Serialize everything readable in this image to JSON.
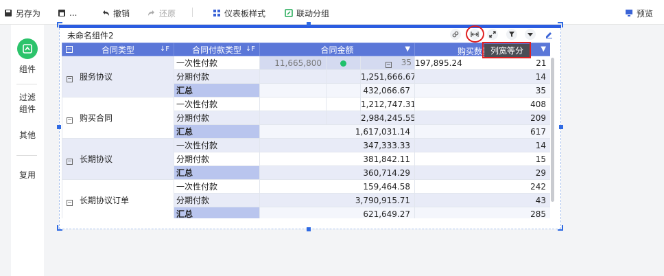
{
  "toolbar": {
    "save_as": "另存为",
    "export": "...",
    "undo": "撤销",
    "redo": "还原",
    "dashboard_style": "仪表板样式",
    "link_group": "联动分组",
    "preview": "预览"
  },
  "sidebar": {
    "items": [
      {
        "label": "组件"
      },
      {
        "label": "过滤\n组件"
      },
      {
        "label": "其他"
      },
      {
        "label": "复用"
      }
    ]
  },
  "widget": {
    "title": "未命名组件2",
    "tooltip": "列宽等分"
  },
  "table": {
    "headers": [
      "合同类型",
      "合同付款类型",
      "合同金额",
      "购买数量"
    ],
    "highlight_cell": {
      "value1": "11,665,800",
      "value2": "35"
    },
    "groups": [
      {
        "name": "服务协议",
        "rows": [
          {
            "type": "一次性付款",
            "amount": "197,895.24",
            "qty": "21"
          },
          {
            "type": "分期付款",
            "amount": "1,251,666.67",
            "qty": "14"
          },
          {
            "type": "汇总",
            "amount": "432,066.67",
            "qty": "35"
          }
        ]
      },
      {
        "name": "购买合同",
        "rows": [
          {
            "type": "一次性付款",
            "amount": "1,212,747.31",
            "qty": "408"
          },
          {
            "type": "分期付款",
            "amount": "2,984,245.55",
            "qty": "209"
          },
          {
            "type": "汇总",
            "amount": "1,617,031.14",
            "qty": "617"
          }
        ]
      },
      {
        "name": "长期协议",
        "rows": [
          {
            "type": "一次性付款",
            "amount": "347,333.33",
            "qty": "14"
          },
          {
            "type": "分期付款",
            "amount": "381,842.11",
            "qty": "15"
          },
          {
            "type": "汇总",
            "amount": "360,714.29",
            "qty": "29"
          }
        ]
      },
      {
        "name": "长期协议订单",
        "rows": [
          {
            "type": "一次性付款",
            "amount": "159,464.58",
            "qty": "242"
          },
          {
            "type": "分期付款",
            "amount": "3,790,915.71",
            "qty": "43"
          },
          {
            "type": "汇总",
            "amount": "621,649.27",
            "qty": "285"
          }
        ]
      }
    ]
  }
}
